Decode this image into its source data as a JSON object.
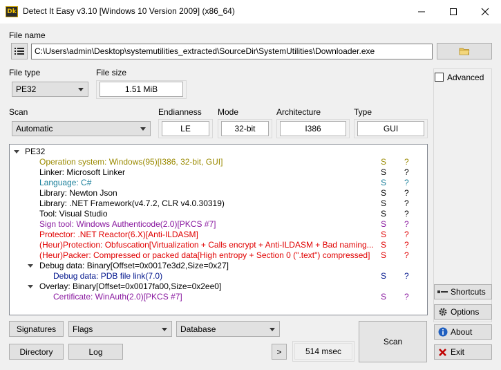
{
  "window": {
    "title": "Detect It Easy v3.10 [Windows 10 Version 2009] (x86_64)",
    "icon_text": "Dk"
  },
  "file": {
    "label": "File name",
    "path": "C:\\Users\\admin\\Desktop\\systemutilities_extracted\\SourceDir\\SystemUtilities\\Downloader.exe"
  },
  "file_type": {
    "label": "File type",
    "value": "PE32"
  },
  "file_size": {
    "label": "File size",
    "value": "1.51 MiB"
  },
  "scan": {
    "label": "Scan",
    "value": "Automatic"
  },
  "endianness": {
    "label": "Endianness",
    "value": "LE"
  },
  "mode": {
    "label": "Mode",
    "value": "32-bit"
  },
  "architecture": {
    "label": "Architecture",
    "value": "I386"
  },
  "type": {
    "label": "Type",
    "value": "GUI"
  },
  "advanced": {
    "label": "Advanced",
    "checked": false
  },
  "colors": {
    "olive": "#9a8a00",
    "teal": "#1a7f9a",
    "purple": "#8a1aa0",
    "red": "#e00000",
    "navy": "#00148c",
    "black": "#000000"
  },
  "results": [
    {
      "text": "PE32",
      "s": "",
      "q": "",
      "color": "#000000",
      "indent": 1,
      "expander": false
    },
    {
      "text": "Operation system: Windows(95)[I386, 32-bit, GUI]",
      "s": "S",
      "q": "?",
      "color": "#9a8a00",
      "indent": 2
    },
    {
      "text": "Linker: Microsoft Linker",
      "s": "S",
      "q": "?",
      "color": "#000000",
      "indent": 2
    },
    {
      "text": "Language: C#",
      "s": "S",
      "q": "?",
      "color": "#1a7f9a",
      "indent": 2
    },
    {
      "text": "Library: Newton Json",
      "s": "S",
      "q": "?",
      "color": "#000000",
      "indent": 2
    },
    {
      "text": "Library: .NET Framework(v4.7.2, CLR v4.0.30319)",
      "s": "S",
      "q": "?",
      "color": "#000000",
      "indent": 2
    },
    {
      "text": "Tool: Visual Studio",
      "s": "S",
      "q": "?",
      "color": "#000000",
      "indent": 2
    },
    {
      "text": "Sign tool: Windows Authenticode(2.0)[PKCS #7]",
      "s": "S",
      "q": "?",
      "color": "#8a1aa0",
      "indent": 2
    },
    {
      "text": "Protector: .NET Reactor(6.X)[Anti-ILDASM]",
      "s": "S",
      "q": "?",
      "color": "#e00000",
      "indent": 2
    },
    {
      "text": "(Heur)Protection: Obfuscation[Virtualization + Calls encrypt + Anti-ILDASM + Bad naming...",
      "s": "S",
      "q": "?",
      "color": "#e00000",
      "indent": 2
    },
    {
      "text": "(Heur)Packer: Compressed or packed data[High entropy + Section 0 (\".text\") compressed]",
      "s": "S",
      "q": "?",
      "color": "#e00000",
      "indent": 2
    },
    {
      "text": "Debug data: Binary[Offset=0x0017e3d2,Size=0x27]",
      "s": "",
      "q": "",
      "color": "#000000",
      "indent": 2,
      "expander": true
    },
    {
      "text": "Debug data: PDB file link(7.0)",
      "s": "S",
      "q": "?",
      "color": "#00148c",
      "indent": 3
    },
    {
      "text": "Overlay: Binary[Offset=0x0017fa00,Size=0x2ee0]",
      "s": "",
      "q": "",
      "color": "#000000",
      "indent": 2,
      "expander": true
    },
    {
      "text": "Certificate: WinAuth(2.0)[PKCS #7]",
      "s": "S",
      "q": "?",
      "color": "#8a1aa0",
      "indent": 3
    }
  ],
  "buttons": {
    "signatures": "Signatures",
    "flags": "Flags",
    "database": "Database",
    "directory": "Directory",
    "log": "Log",
    "more": ">",
    "scan": "Scan",
    "time": "514 msec",
    "shortcuts": "Shortcuts",
    "options": "Options",
    "about": "About",
    "exit": "Exit"
  }
}
